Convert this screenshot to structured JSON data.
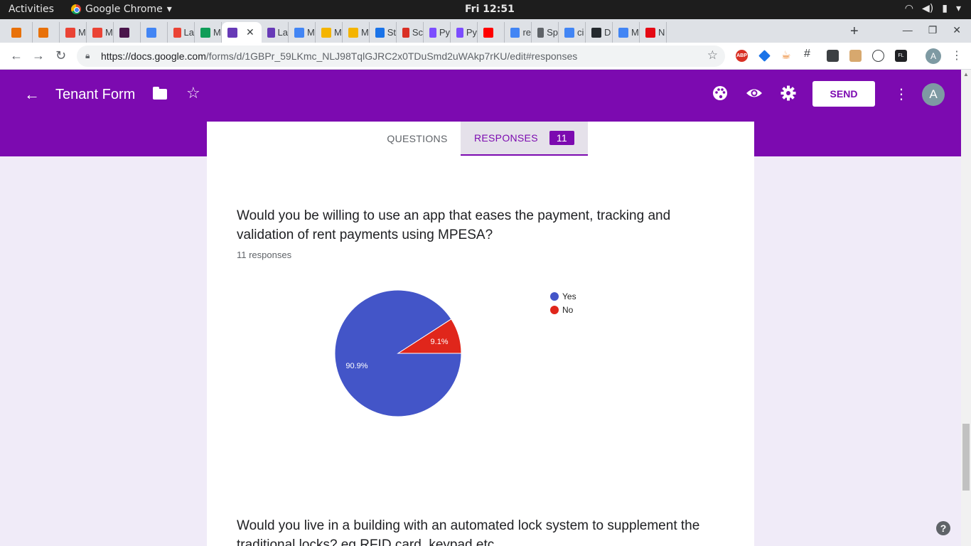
{
  "system": {
    "activities": "Activities",
    "app_name": "Google Chrome",
    "clock": "Fri 12:51"
  },
  "tabs": [
    {
      "label": "",
      "color": "#e8710a"
    },
    {
      "label": "",
      "color": "#e8710a"
    },
    {
      "label": "M",
      "color": "#ea4335"
    },
    {
      "label": "M",
      "color": "#ea4335"
    },
    {
      "label": "",
      "color": "#4a154b"
    },
    {
      "label": "",
      "color": "#4285f4"
    },
    {
      "label": "La",
      "color": "#ea4335"
    },
    {
      "label": "M",
      "color": "#0f9d58"
    },
    {
      "label": "",
      "color": "#673ab7",
      "active": true
    },
    {
      "label": "La",
      "color": "#673ab7"
    },
    {
      "label": "M",
      "color": "#4285f4"
    },
    {
      "label": "M",
      "color": "#f4b400"
    },
    {
      "label": "M",
      "color": "#f4b400"
    },
    {
      "label": "St",
      "color": "#1a73e8"
    },
    {
      "label": "Sc",
      "color": "#d93025"
    },
    {
      "label": "Py",
      "color": "#7c4dff"
    },
    {
      "label": "Py",
      "color": "#7c4dff"
    },
    {
      "label": "",
      "color": "#ff0000"
    },
    {
      "label": "re",
      "color": "#4285f4"
    },
    {
      "label": "Sp",
      "color": "#5f6368"
    },
    {
      "label": "ci",
      "color": "#4285f4"
    },
    {
      "label": "D",
      "color": "#24292e"
    },
    {
      "label": "M",
      "color": "#4285f4"
    },
    {
      "label": "N",
      "color": "#e50914"
    }
  ],
  "address": {
    "host": "https://docs.google.com",
    "path": "/forms/d/1GBPr_59LKmc_NLJ98TqlGJRC2x0TDuSmd2uWAkp7rKU/edit#responses",
    "ext_abp": "ABP",
    "ext_fl": "FL",
    "profile_initial": "A"
  },
  "form": {
    "title": "Tenant Form",
    "send_label": "SEND",
    "avatar_initial": "A",
    "tab_questions": "QUESTIONS",
    "tab_responses": "RESPONSES",
    "response_count": "11",
    "accent_color": "#7c0ab0"
  },
  "question1": {
    "title": "Would you be willing to use an app that eases the payment, tracking and validation of rent payments using MPESA?",
    "responses_label": "11 responses"
  },
  "question2": {
    "title": "Would you live in a building with an automated lock system to supplement the traditional locks? eg RFID card, keypad etc"
  },
  "chart_data": {
    "type": "pie",
    "labels": [
      "Yes",
      "No"
    ],
    "values": [
      90.9,
      9.1
    ],
    "slice_labels": [
      "90.9%",
      "9.1%"
    ],
    "colors": [
      "#4355c8",
      "#e0261b"
    ],
    "legend_position": "right"
  }
}
